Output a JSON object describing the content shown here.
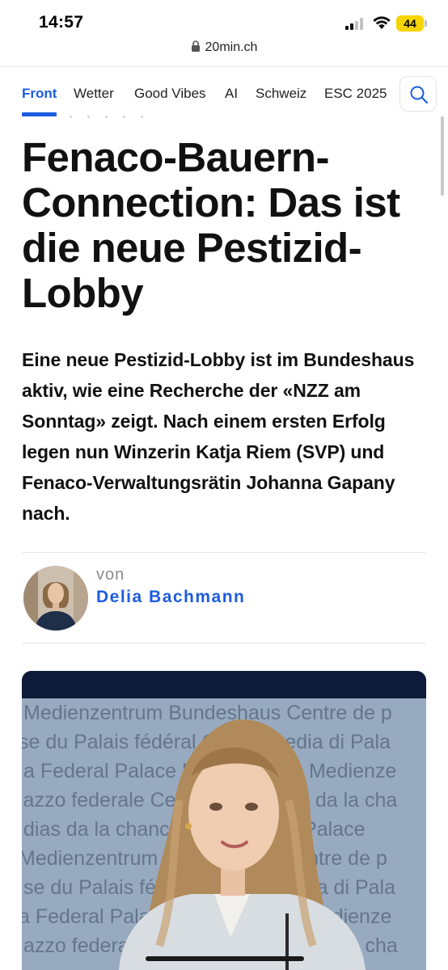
{
  "status_bar": {
    "time": "14:57",
    "battery": "44",
    "battery_color": "#f5d400"
  },
  "browser": {
    "url": "20min.ch",
    "lock_icon": "lock-icon"
  },
  "nav": {
    "items": [
      {
        "label": "Front",
        "active": true
      },
      {
        "label": "Wetter",
        "active": false
      },
      {
        "label": "Good Vibes",
        "active": false
      },
      {
        "label": "AI",
        "active": false
      },
      {
        "label": "Schweiz",
        "active": false
      },
      {
        "label": "ESC 2025",
        "active": false
      }
    ],
    "search_icon": "search-icon",
    "accent_color": "#1d5ce0"
  },
  "article": {
    "headline": "Fenaco-Bauern-Connection: Das ist die neue Pestizid-Lobby",
    "lead": "Eine neue Pestizid-Lobby ist im Bundeshaus aktiv, wie eine Recherche der «NZZ am Sonntag» zeigt. Nach einem ersten Erfolg legen nun Winzerin Katja Riem (SVP) und Fenaco-Verwaltungsrätin Johanna Gapany nach.",
    "author": {
      "prefix": "von",
      "name": "Delia Bachmann"
    },
    "hero_backdrop_lines": [
      "Medienzentrum Bundeshaus  Centre de p",
      "se du Palais fédéral  Centro media di Pala",
      "a  Federal Palace Media Centre  Medienze",
      "lazzo federale  Center da medias da la cha",
      "dias da la chancellaria  Federal Palace",
      "Medienzentrum Bundeshaus  Centre de p",
      "se du Palais fédéral  Centro media di Pala",
      "a  Federal Palace Media Centre  Medienze",
      "azzo federale  Center da medias da la cha"
    ]
  }
}
